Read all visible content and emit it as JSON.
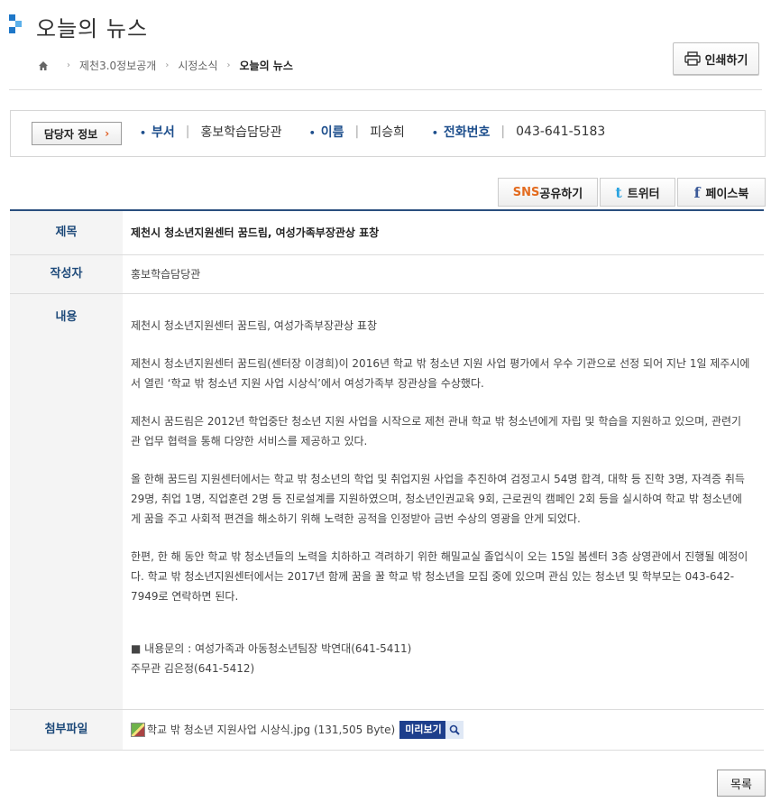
{
  "header": {
    "title": "오늘의 뉴스",
    "print_label": "인쇄하기"
  },
  "breadcrumb": {
    "items": [
      "제천3.0정보공개",
      "시정소식"
    ],
    "current": "오늘의 뉴스"
  },
  "contact": {
    "label": "담당자 정보",
    "dept_key": "부서",
    "dept_value": "홍보학습담당관",
    "name_key": "이름",
    "name_value": "피승희",
    "phone_key": "전화번호",
    "phone_value": "043-641-5183"
  },
  "sns": {
    "share_prefix": "SNS",
    "share_suffix": "공유하기",
    "twitter": "트위터",
    "facebook": "페이스북"
  },
  "article": {
    "title_header": "제목",
    "title": "제천시 청소년지원센터 꿈드림, 여성가족부장관상 표창",
    "author_header": "작성자",
    "author": "홍보학습담당관",
    "content_header": "내용",
    "paragraphs": [
      "제천시 청소년지원센터 꿈드림, 여성가족부장관상 표창",
      "제천시 청소년지원센터 꿈드림(센터장 이경희)이 2016년 학교 밖 청소년 지원 사업 평가에서 우수 기관으로 선정 되어 지난 1일 제주시에서 열린 ‘학교 밖 청소년 지원 사업 시상식’에서 여성가족부 장관상을 수상했다.",
      "제천시 꿈드림은 2012년 학업중단 청소년 지원 사업을 시작으로 제천 관내 학교 밖 청소년에게 자립 및 학습을 지원하고 있으며, 관련기관 업무 협력을 통해 다양한 서비스를 제공하고 있다.",
      "올 한해 꿈드림 지원센터에서는 학교 밖 청소년의 학업 및 취업지원 사업을 추진하여 검정고시 54명 합격, 대학 등 진학 3명, 자격증 취득 29명, 취업 1명, 직업훈련 2명 등 진로설계를 지원하였으며, 청소년인권교육 9회, 근로권익 캠페인 2회 등을 실시하여 학교 밖 청소년에게 꿈을 주고 사회적 편견을 해소하기 위해 노력한 공적을 인정받아 금번 수상의 영광을 안게 되었다.",
      "한편, 한 해 동안 학교 밖 청소년들의 노력을 치하하고 격려하기 위한 해밀교실 졸업식이 오는 15일 봄센터 3층 상영관에서 진행될 예정이다. 학교 밖 청소년지원센터에서는 2017년 함께 꿈을 꿀 학교 밖 청소년을 모집 중에 있으며 관심 있는 청소년 및 학부모는 043-642-7949로 연락하면 된다."
    ],
    "inquiry_line1": "■ 내용문의 : 여성가족과 아동청소년팀장 박연대(641-5411)",
    "inquiry_line2": "주무관 김은정(641-5412)",
    "file_header": "첨부파일",
    "file_name": "학교 밖 청소년 지원사업 시상식.jpg (131,505 Byte)",
    "preview_label": "미리보기"
  },
  "footer": {
    "list_label": "목록"
  },
  "colors": {
    "accent_navy": "#1e4a7a",
    "table_border": "#2a4f7e",
    "sns_orange": "#e36b1f",
    "twitter_blue": "#2aa3e0",
    "facebook_blue": "#3b5998",
    "preview_bg": "#1e3f8c"
  }
}
